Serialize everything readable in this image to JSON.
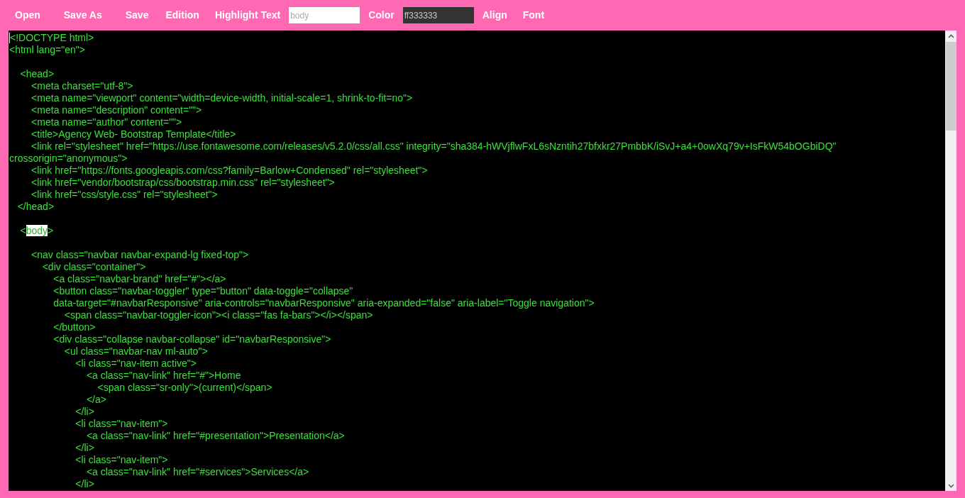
{
  "toolbar": [
    {
      "kind": "button",
      "label": "Open"
    },
    {
      "kind": "button",
      "label": "Save As"
    },
    {
      "kind": "button",
      "label": "Save"
    },
    {
      "kind": "button",
      "label": "Edition"
    },
    {
      "kind": "button",
      "label": "Highlight Text"
    },
    {
      "kind": "input",
      "placeholder": "body"
    },
    {
      "kind": "button",
      "label": "Color"
    },
    {
      "kind": "color_input",
      "value": "ff333333"
    },
    {
      "kind": "button",
      "label": "Align"
    },
    {
      "kind": "button",
      "label": "Font"
    }
  ],
  "editor": {
    "lines": [
      {
        "text": "<!DOCTYPE html>"
      },
      {
        "text": "<html lang=\"en\">"
      },
      {
        "text": "    <head>",
        "space_before": true
      },
      {
        "text": "        <meta charset=\"utf-8\">"
      },
      {
        "text": "        <meta name=\"viewport\" content=\"width=device-width, initial-scale=1, shrink-to-fit=no\">"
      },
      {
        "text": "        <meta name=\"description\" content=\"\">"
      },
      {
        "text": "        <meta name=\"author\" content=\"\">"
      },
      {
        "text": "        <title>Agency Web- Bootstrap Template</title>"
      },
      {
        "text": "        <link rel=\"stylesheet\" href=\"https://use.fontawesome.com/releases/v5.2.0/css/all.css\" integrity=\"sha384-hWVjflwFxL6sNzntih27bfxkr27PmbbK/iSvJ+a4+0owXq79v+IsFkW54bOGbiDQ\""
      },
      {
        "text": "crossorigin=\"anonymous\">"
      },
      {
        "text": "        <link href=\"https://fonts.googleapis.com/css?family=Barlow+Condensed\" rel=\"stylesheet\">"
      },
      {
        "text": "        <link href=\"vendor/bootstrap/css/bootstrap.min.css\" rel=\"stylesheet\">"
      },
      {
        "text": "        <link href=\"css/style.css\" rel=\"stylesheet\">"
      },
      {
        "text": "   </head>"
      },
      {
        "space_before": true,
        "segments": [
          {
            "text": "    <",
            "highlighted": false
          },
          {
            "text": "body",
            "highlighted": true
          },
          {
            "text": ">",
            "highlighted": false
          }
        ]
      },
      {
        "text": "        <nav class=\"navbar navbar-expand-lg fixed-top\">",
        "space_before": true
      },
      {
        "text": "            <div class=\"container\">"
      },
      {
        "text": "                <a class=\"navbar-brand\" href=\"#\"></a>"
      },
      {
        "text": "                <button class=\"navbar-toggler\" type=\"button\" data-toggle=\"collapse\""
      },
      {
        "text": "                data-target=\"#navbarResponsive\" aria-controls=\"navbarResponsive\" aria-expanded=\"false\" aria-label=\"Toggle navigation\">"
      },
      {
        "text": "                    <span class=\"navbar-toggler-icon\"><i class=\"fas fa-bars\"></i></span>"
      },
      {
        "text": "                </button>"
      },
      {
        "text": "                <div class=\"collapse navbar-collapse\" id=\"navbarResponsive\">"
      },
      {
        "text": "                    <ul class=\"navbar-nav ml-auto\">"
      },
      {
        "text": "                        <li class=\"nav-item active\">"
      },
      {
        "text": "                            <a class=\"nav-link\" href=\"#\">Home"
      },
      {
        "text": "                                <span class=\"sr-only\">(current)</span>"
      },
      {
        "text": "                            </a>"
      },
      {
        "text": "                        </li>"
      },
      {
        "text": "                        <li class=\"nav-item\">"
      },
      {
        "text": "                            <a class=\"nav-link\" href=\"#presentation\">Presentation</a>"
      },
      {
        "text": "                        </li>"
      },
      {
        "text": "                        <li class=\"nav-item\">"
      },
      {
        "text": "                            <a class=\"nav-link\" href=\"#services\">Services</a>"
      },
      {
        "text": "                        </li>"
      }
    ]
  }
}
